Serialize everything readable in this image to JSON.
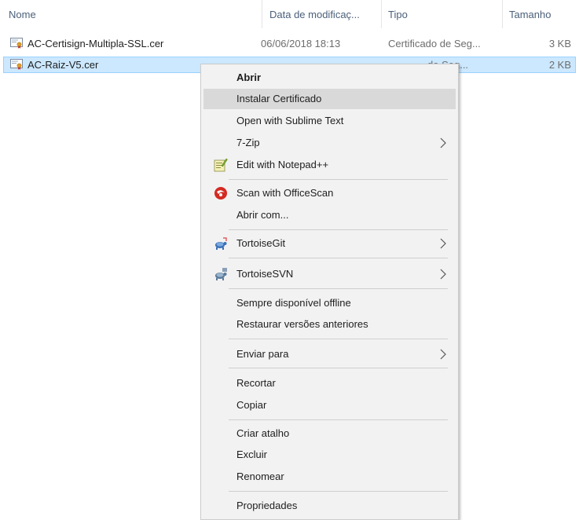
{
  "columns": {
    "name": "Nome",
    "date": "Data de modificaç...",
    "type": "Tipo",
    "size": "Tamanho"
  },
  "files": [
    {
      "name": "AC-Certisign-Multipla-SSL.cer",
      "date": "06/06/2018 18:13",
      "type": "Certificado de Seg...",
      "size": "3 KB",
      "icon": "certificate-icon"
    },
    {
      "name": "AC-Raiz-V5.cer",
      "date": "",
      "type": "de Seg...",
      "size": "2 KB",
      "icon": "certificate-icon",
      "selected": true
    }
  ],
  "context_menu": {
    "items": [
      {
        "label": "Abrir",
        "bold": true
      },
      {
        "label": "Instalar Certificado",
        "highlighted": true
      },
      {
        "label": "Open with Sublime Text"
      },
      {
        "label": "7-Zip",
        "submenu": true
      },
      {
        "label": "Edit with Notepad++",
        "icon": "notepadplusplus-icon"
      },
      {
        "label": "Scan with OfficeScan",
        "icon": "officescan-icon"
      },
      {
        "label": "Abrir com..."
      },
      {
        "label": "TortoiseGit",
        "icon": "tortoisegit-icon",
        "submenu": true
      },
      {
        "label": "TortoiseSVN",
        "icon": "tortoisesvn-icon",
        "submenu": true
      },
      {
        "label": "Sempre disponível offline"
      },
      {
        "label": "Restaurar versões anteriores"
      },
      {
        "label": "Enviar para",
        "submenu": true
      },
      {
        "label": "Recortar"
      },
      {
        "label": "Copiar"
      },
      {
        "label": "Criar atalho"
      },
      {
        "label": "Excluir"
      },
      {
        "label": "Renomear"
      },
      {
        "label": "Propriedades"
      }
    ]
  },
  "colors": {
    "selection_bg": "#cce8ff",
    "selection_border": "#99d1ff",
    "menu_bg": "#f2f2f2",
    "menu_highlight": "#d9d9d9",
    "header_text": "#4c607a"
  }
}
